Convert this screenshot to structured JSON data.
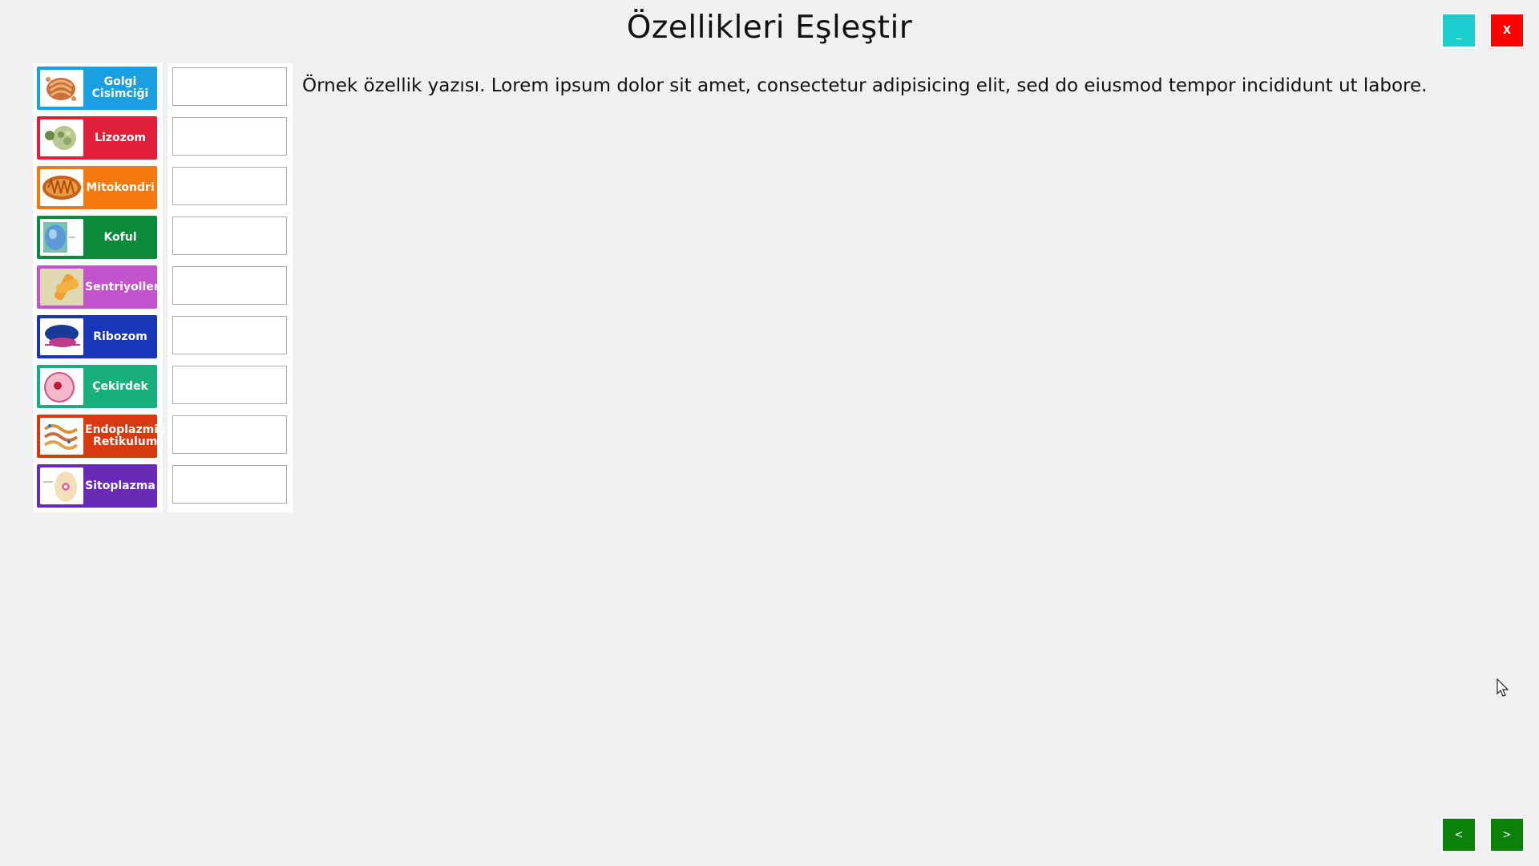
{
  "title": "Özellikleri Eşleştir",
  "window_controls": {
    "minimize_label": "_",
    "close_label": "X",
    "minimize_color": "#1ccfcf",
    "close_color": "#ff0000"
  },
  "description": "Örnek özellik yazısı. Lorem ipsum dolor sit amet, consectetur adipisicing elit, sed do eiusmod tempor incididunt ut labore.",
  "cards": [
    {
      "label": "Golgi Cisimciği",
      "color": "#1a9fe0",
      "icon": "golgi-icon"
    },
    {
      "label": "Lizozom",
      "color": "#e0203a",
      "icon": "lysosome-icon"
    },
    {
      "label": "Mitokondri",
      "color": "#f47a10",
      "icon": "mitochondria-icon"
    },
    {
      "label": "Koful",
      "color": "#0a8a3a",
      "icon": "vacuole-icon"
    },
    {
      "label": "Sentriyoller",
      "color": "#c253cc",
      "icon": "centriole-icon"
    },
    {
      "label": "Ribozom",
      "color": "#1a36b8",
      "icon": "ribosome-icon"
    },
    {
      "label": "Çekirdek",
      "color": "#18b07a",
      "icon": "nucleus-icon"
    },
    {
      "label": "Endoplazmik Retikulum",
      "color": "#d83a10",
      "icon": "endoplasmic-reticulum-icon"
    },
    {
      "label": "Sitoplazma",
      "color": "#6a2ab8",
      "icon": "cytoplasm-icon"
    }
  ],
  "answers": [
    "",
    "",
    "",
    "",
    "",
    "",
    "",
    "",
    ""
  ],
  "navigation": {
    "prev_label": "<",
    "next_label": ">",
    "color": "#0a820a"
  }
}
